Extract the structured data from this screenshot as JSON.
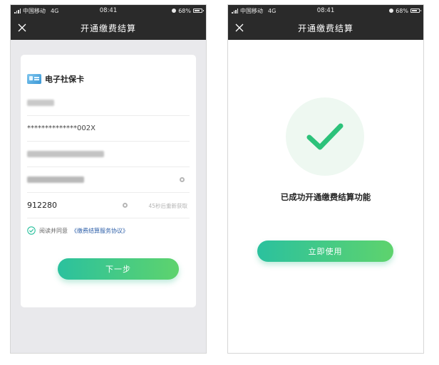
{
  "status_bar": {
    "carrier": "中国移动",
    "network": "4G",
    "time": "08:41",
    "battery": "68%"
  },
  "left_screen": {
    "title": "开通缴费结算",
    "card_title": "电子社保卡",
    "id_number_value": "**************002X",
    "verification_code_value": "912280",
    "resend_label": "45秒后重新获取",
    "agree_prefix": "阅读并同意",
    "agreement_link": "《缴费结算服务协议》",
    "agree_checked": true,
    "next_button": "下一步"
  },
  "right_screen": {
    "title": "开通缴费结算",
    "success_message": "已成功开通缴费结算功能",
    "use_button": "立即使用"
  },
  "colors": {
    "nav_background": "#2a2a2a",
    "accent_start": "#2bc19e",
    "accent_end": "#5ed36d",
    "link": "#2c5ea8",
    "success_bg": "#eef8f1"
  }
}
